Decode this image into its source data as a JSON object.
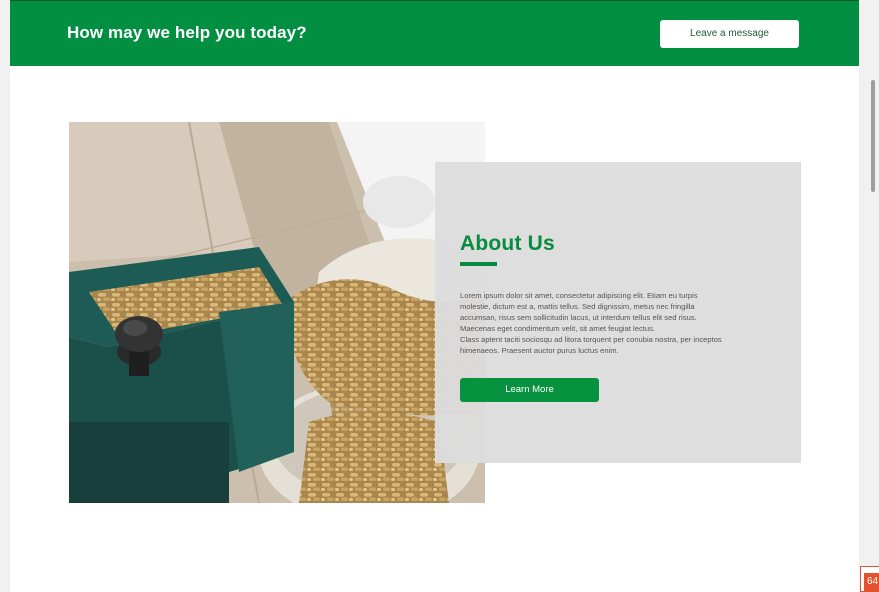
{
  "header": {
    "title": "How may we help you today?",
    "leave_message_label": "Leave a message"
  },
  "about": {
    "title": "About Us",
    "body_lines": [
      "Lorem ipsum dolor sit amet, consectetur adipiscing elit. Etiam eu turpis",
      "molestie, dictum est a, mattis tellus. Sed dignissim, metus nec fringilla",
      "accumsan, risus sem sollicitudin lacus, ut interdum tellus elit sed risus.",
      "Maecenas eget condimentum velit, sit amet feugiat lectus.",
      "Class aptent taciti sociosqu ad litora torquent per conubia nostra, per inceptos",
      "himenaeos. Praesent auctor purus luctus enim."
    ],
    "learn_more_label": "Learn More"
  },
  "badge": {
    "text": "64"
  },
  "colors": {
    "brand_green": "#038f41",
    "button_green": "#07923f",
    "card_gray": "#dddddd",
    "badge_red": "#e3512f"
  }
}
